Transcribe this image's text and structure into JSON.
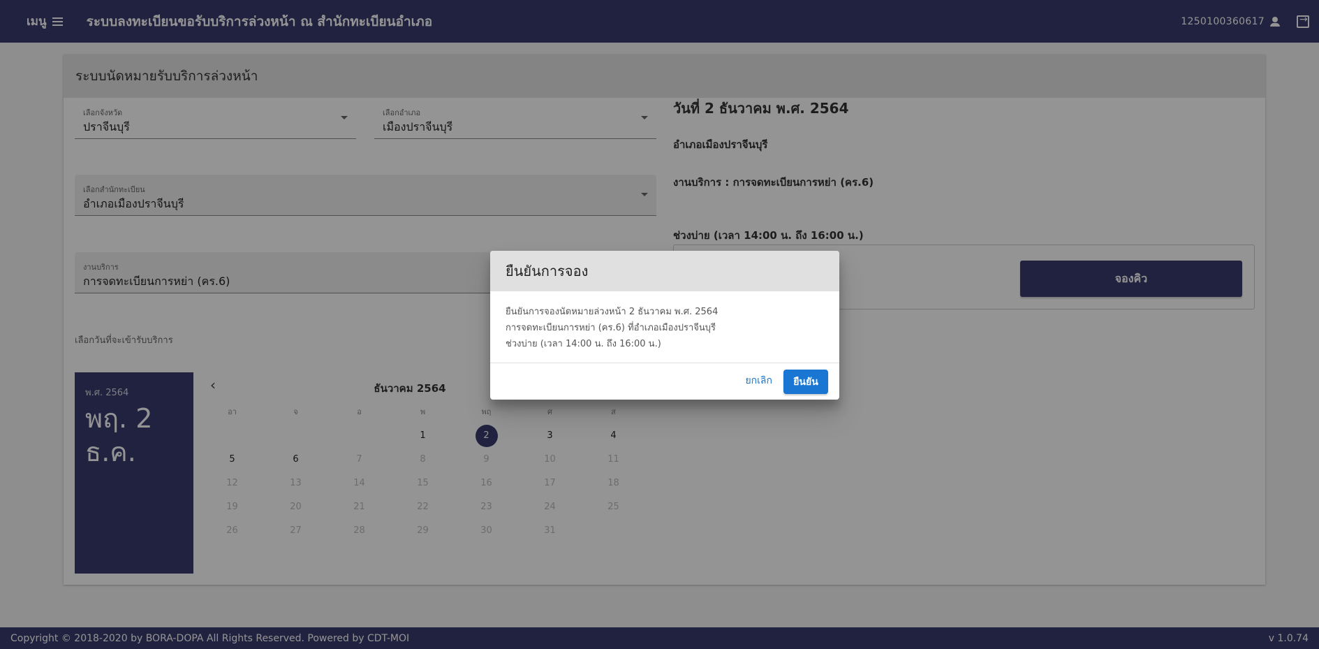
{
  "header": {
    "menu_label": "เมนู",
    "title": "ระบบลงทะเบียนขอรับบริการล่วงหน้า ณ สำนักทะเบียนอำเภอ",
    "user_id": "1250100360617"
  },
  "card": {
    "title": "ระบบนัดหมายรับบริการล่วงหน้า",
    "province": {
      "label": "เลือกจังหวัด",
      "value": "ปราจีนบุรี"
    },
    "district": {
      "label": "เลือกอำเภอ",
      "value": "เมืองปราจีนบุรี"
    },
    "office": {
      "label": "เลือกสำนักทะเบียน",
      "value": "อำเภอเมืองปราจีนบุรี"
    },
    "service": {
      "label": "งานบริการ",
      "value": "การจดทะเบียนการหย่า (คร.6)"
    },
    "date_hint": "เลือกวันที่จะเข้ารับบริการ"
  },
  "date_panel": {
    "year": "พ.ศ. 2564",
    "line1": "พฤ. 2",
    "line2": "ธ.ค."
  },
  "calendar": {
    "month": "ธันวาคม 2564",
    "weekdays": [
      "อา",
      "จ",
      "อ",
      "พ",
      "พฤ",
      "ศ",
      "ส"
    ],
    "selected_day": 2,
    "available_days": [
      1,
      2,
      3,
      4,
      5,
      6
    ],
    "days": [
      "",
      "",
      "",
      "1",
      "2",
      "3",
      "4",
      "5",
      "6",
      "7",
      "8",
      "9",
      "10",
      "11",
      "12",
      "13",
      "14",
      "15",
      "16",
      "17",
      "18",
      "19",
      "20",
      "21",
      "22",
      "23",
      "24",
      "25",
      "26",
      "27",
      "28",
      "29",
      "30",
      "31"
    ]
  },
  "summary": {
    "date": "วันที่ 2 ธันวาคม พ.ศ. 2564",
    "office": "อำเภอเมืองปราจีนบุรี",
    "service": "งานบริการ : การจดทะเบียนการหย่า (คร.6)",
    "slot": "ช่วงบ่าย (เวลา 14:00 น. ถึง 16:00 น.)",
    "book_button": "จองคิว"
  },
  "dialog": {
    "title": "ยืนยันการจอง",
    "line1": "ยืนยันการจองนัดหมายล่วงหน้า 2 ธันวาคม พ.ศ. 2564",
    "line2": "การจดทะเบียนการหย่า (คร.6) ที่อำเภอเมืองปราจีนบุรี",
    "line3": "ช่วงบ่าย (เวลา 14:00 น. ถึง 16:00 น.)",
    "cancel": "ยกเลิก",
    "confirm": "ยืนยัน"
  },
  "footer": {
    "copyright": "Copyright © 2018-2020 by BORA-DOPA All Rights Reserved. Powered by CDT-MOI",
    "version": "v 1.0.74"
  }
}
